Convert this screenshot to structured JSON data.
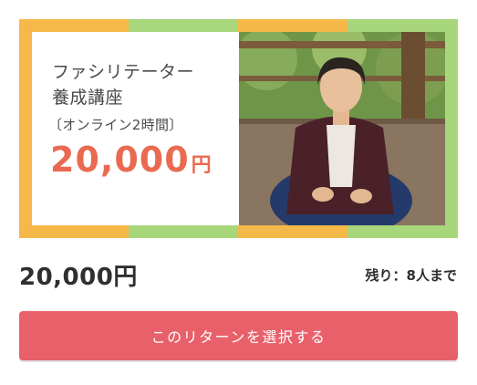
{
  "colors": {
    "stripe_orange": "#f5b94a",
    "stripe_green": "#a8d67a",
    "price_accent": "#ea6a51",
    "button": "#e8616a"
  },
  "banner": {
    "title": "ファシリテーター\n養成講座",
    "subtitle": "〔オンライン2時間〕",
    "price_number": "20,000",
    "price_unit": "円",
    "photo_icon": "person-portrait-icon"
  },
  "reward": {
    "price": "20,000円",
    "remaining": "残り：8人まで"
  },
  "button": {
    "label": "このリターンを選択する"
  }
}
